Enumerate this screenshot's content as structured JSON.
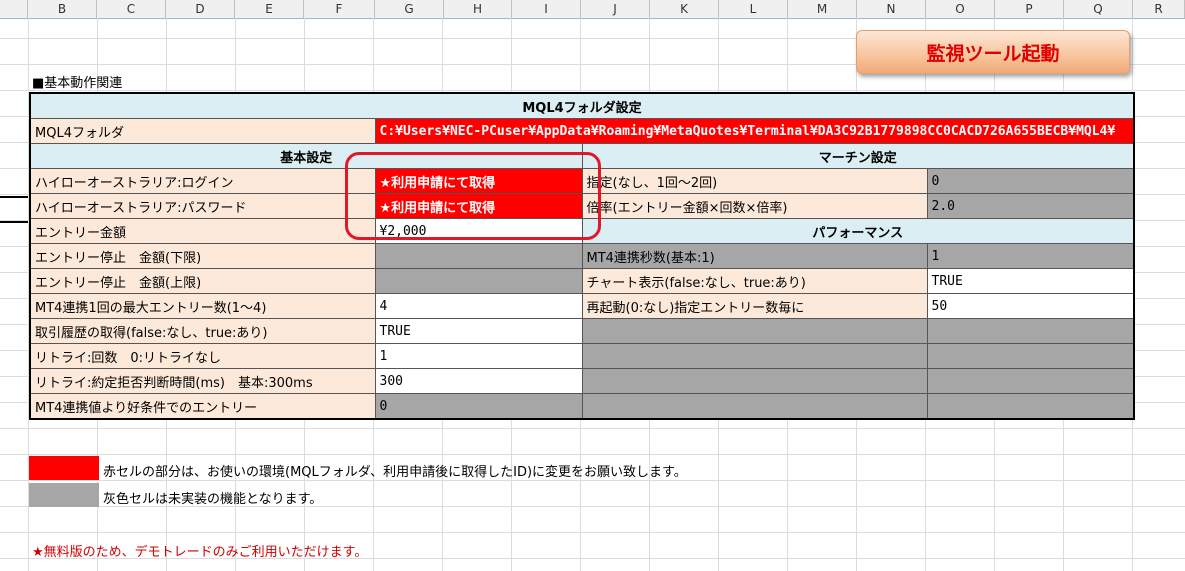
{
  "columns": [
    "B",
    "C",
    "D",
    "E",
    "F",
    "G",
    "H",
    "I",
    "J",
    "K",
    "L",
    "M",
    "N",
    "O",
    "P",
    "Q",
    "R"
  ],
  "launch_button": "監視ツール起動",
  "section_title": "■基本動作関連",
  "mql_header": "MQL4フォルダ設定",
  "mql_label": "MQL4フォルダ",
  "mql_path": "C:¥Users¥NEC-PCuser¥AppData¥Roaming¥MetaQuotes¥Terminal¥DA3C92B1779898CC0CACD726A655BECB¥MQL4¥",
  "basic_header": "基本設定",
  "martin_header": "マーチン設定",
  "perf_header": "パフォーマンス",
  "basic": [
    {
      "label": "ハイローオーストラリア:ログイン",
      "value": "★利用申請にて取得",
      "style": "red"
    },
    {
      "label": "ハイローオーストラリア:パスワード",
      "value": "★利用申請にて取得",
      "style": "red"
    },
    {
      "label": "エントリー金額",
      "value": "¥2,000",
      "style": "white"
    },
    {
      "label": "エントリー停止　金額(下限)",
      "value": "",
      "style": "gray"
    },
    {
      "label": "エントリー停止　金額(上限)",
      "value": "",
      "style": "gray"
    },
    {
      "label": "MT4連携1回の最大エントリー数(1〜4)",
      "value": "4",
      "style": "white"
    },
    {
      "label": "取引履歴の取得(false:なし、true:あり)",
      "value": "TRUE",
      "style": "white"
    },
    {
      "label": "リトライ:回数　0:リトライなし",
      "value": "1",
      "style": "white"
    },
    {
      "label": "リトライ:約定拒否判断時間(ms)　基本:300ms",
      "value": "300",
      "style": "white"
    },
    {
      "label": "MT4連携値より好条件でのエントリー",
      "value": "0",
      "style": "gray"
    }
  ],
  "martin": [
    {
      "label": "指定(なし、1回〜2回)",
      "value": "0",
      "style": "gray"
    },
    {
      "label": "倍率(エントリー金額×回数×倍率)",
      "value": "2.0",
      "style": "gray"
    }
  ],
  "perf": [
    {
      "label": "MT4連携秒数(基本:1)",
      "value": "1",
      "label_style": "gray",
      "style": "gray"
    },
    {
      "label": "チャート表示(false:なし、true:あり)",
      "value": "TRUE",
      "label_style": "lbl",
      "style": "white"
    },
    {
      "label": "再起動(0:なし)指定エントリー数毎に",
      "value": "50",
      "label_style": "lbl",
      "style": "white"
    }
  ],
  "legend": [
    {
      "color": "#ff0000",
      "text": "赤セルの部分は、お使いの環境(MQLフォルダ、利用申請後に取得したID)に変更をお願い致します。"
    },
    {
      "color": "#a6a6a6",
      "text": "灰色セルは未実装の機能となります。"
    }
  ],
  "free_note": "★無料版のため、デモトレードのみご利用いただけます。",
  "colors": {
    "red": "#ff0000",
    "gray": "#a6a6a6",
    "header_blue": "#daeef3",
    "label_peach": "#fde9d9"
  }
}
